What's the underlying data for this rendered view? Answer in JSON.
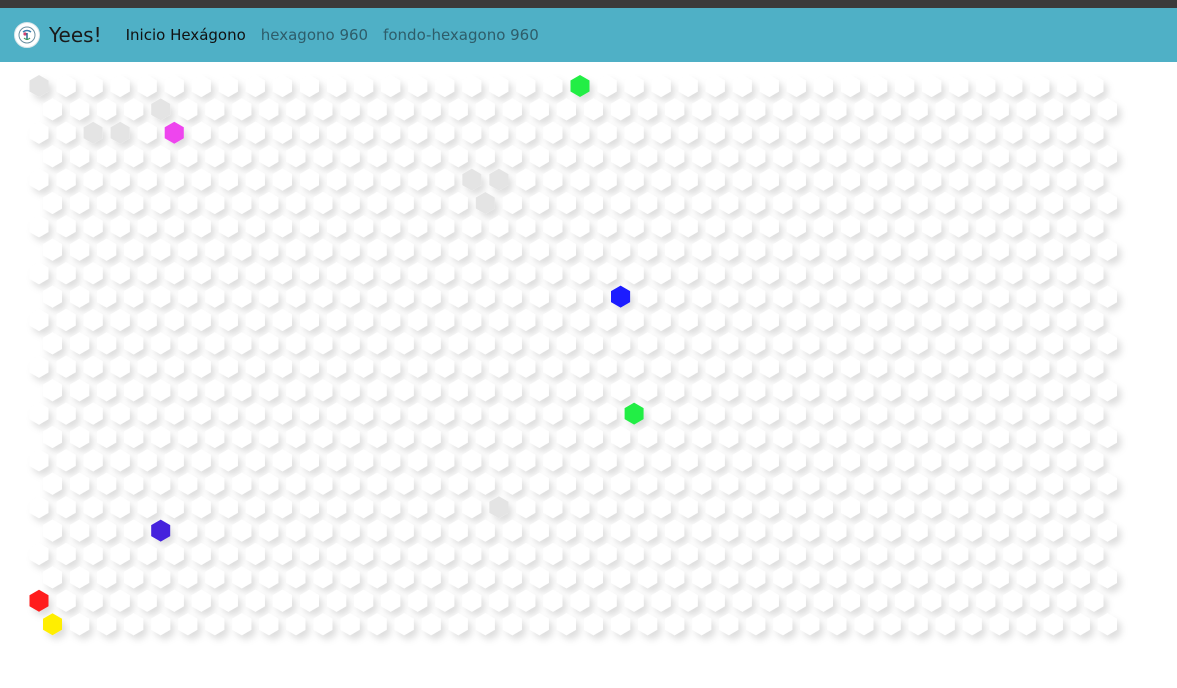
{
  "navbar": {
    "brand": "Yees!",
    "links": [
      {
        "label": "Inicio Hexágono",
        "active": true
      },
      {
        "label": "hexagono 960",
        "active": false
      },
      {
        "label": "fondo-hexagono 960",
        "active": false
      }
    ],
    "background_color": "#4fb0c6"
  },
  "board": {
    "rows": 24,
    "colored_hexagons": [
      {
        "row": 0,
        "col": 20,
        "color": "#22ee44"
      },
      {
        "row": 2,
        "col": 5,
        "color": "#ee44ee"
      },
      {
        "row": 9,
        "col": 21,
        "color": "#1a1aff"
      },
      {
        "row": 14,
        "col": 22,
        "color": "#22ee44"
      },
      {
        "row": 19,
        "col": 4,
        "color": "#4422dd"
      },
      {
        "row": 22,
        "col": 0,
        "color": "#ff1a1a"
      },
      {
        "row": 23,
        "col": 0,
        "color": "#ffee00"
      }
    ],
    "shaded_hexagons": [
      {
        "row": 0,
        "col": 0
      },
      {
        "row": 1,
        "col": 4
      },
      {
        "row": 2,
        "col": 2
      },
      {
        "row": 2,
        "col": 3
      },
      {
        "row": 4,
        "col": 16
      },
      {
        "row": 4,
        "col": 17
      },
      {
        "row": 5,
        "col": 16
      },
      {
        "row": 18,
        "col": 17
      }
    ]
  }
}
